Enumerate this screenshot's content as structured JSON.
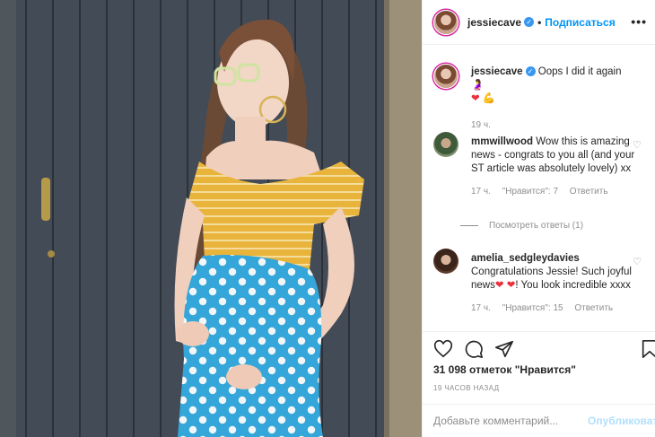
{
  "post": {
    "author": "jessiecave",
    "follow_label": "Подписаться",
    "more_glyph": "•••",
    "caption_text": "Oops I did it again",
    "caption_time": "19 ч.",
    "comments": [
      {
        "user": "mmwillwood",
        "text": "Wow this is amazing news - congrats to you all (and your ST article was absolutely lovely) xx",
        "time": "17 ч.",
        "likes": "\"Нравится\": 7",
        "reply": "Ответить",
        "view_replies": "Посмотреть ответы (1)"
      },
      {
        "user": "amelia_sedgleydavies",
        "text_a": "Congratulations Jessie! Such joyful news",
        "text_b": "! You look incredible xxxx",
        "time": "17 ч.",
        "likes": "\"Нравится\": 15",
        "reply": "Ответить"
      }
    ],
    "likes_count": "31 098 отметок \"Нравится\"",
    "posted_ago": "19 ЧАСОВ НАЗАД",
    "comment_placeholder": "Добавьте комментарий...",
    "publish_label": "Опубликовать"
  },
  "icons": {
    "heart": "heart-icon",
    "comment": "comment-icon",
    "share": "share-icon",
    "bookmark": "bookmark-icon"
  },
  "colors": {
    "accent": "#0095f6",
    "verified": "#3897f0",
    "muted": "#8e8e8e"
  }
}
